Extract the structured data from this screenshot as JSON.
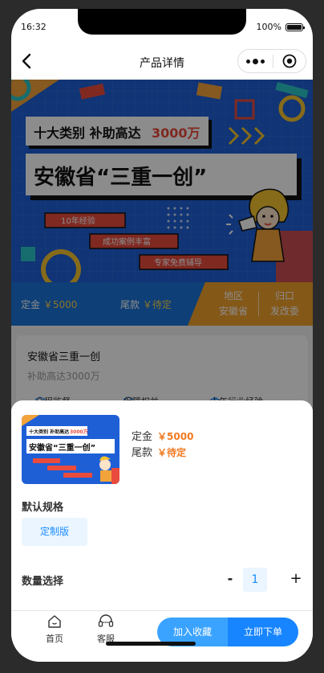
{
  "status": {
    "time": "16:32",
    "battery": "100%"
  },
  "nav": {
    "title": "产品详情"
  },
  "banner": {
    "line1_a": "十大类别 补助高达",
    "line1_b": "3000万",
    "line2": "安徽省“三重一创”",
    "tag1": "10年经验",
    "tag2": "成功案例丰富",
    "tag3": "专家免费辅导"
  },
  "pricebar": {
    "deposit_label": "定金",
    "deposit_value": "￥5000",
    "final_label": "尾款",
    "final_value": "￥待定",
    "region_label": "地区",
    "region_value": "安徽省",
    "dept_label": "归口",
    "dept_value": "发改委"
  },
  "product": {
    "name": "安徽省三重一创",
    "subtitle": "补助高达3000万",
    "tags": [
      "全程监督",
      "保障权益",
      "十年行业经验"
    ]
  },
  "sheet": {
    "deposit_label": "定金",
    "deposit_value": "￥5000",
    "final_label": "尾款",
    "final_value": "￥待定",
    "spec_label": "默认规格",
    "spec_option": "定制版",
    "qty_label": "数量选择",
    "qty_minus": "-",
    "qty_value": "1",
    "qty_plus": "+"
  },
  "bottom": {
    "home": "首页",
    "service": "客服",
    "fav": "加入收藏",
    "order": "立即下单"
  },
  "colors": {
    "accent": "#1785ff",
    "price": "#f07a21",
    "banner_blue": "#1e5fd6"
  }
}
